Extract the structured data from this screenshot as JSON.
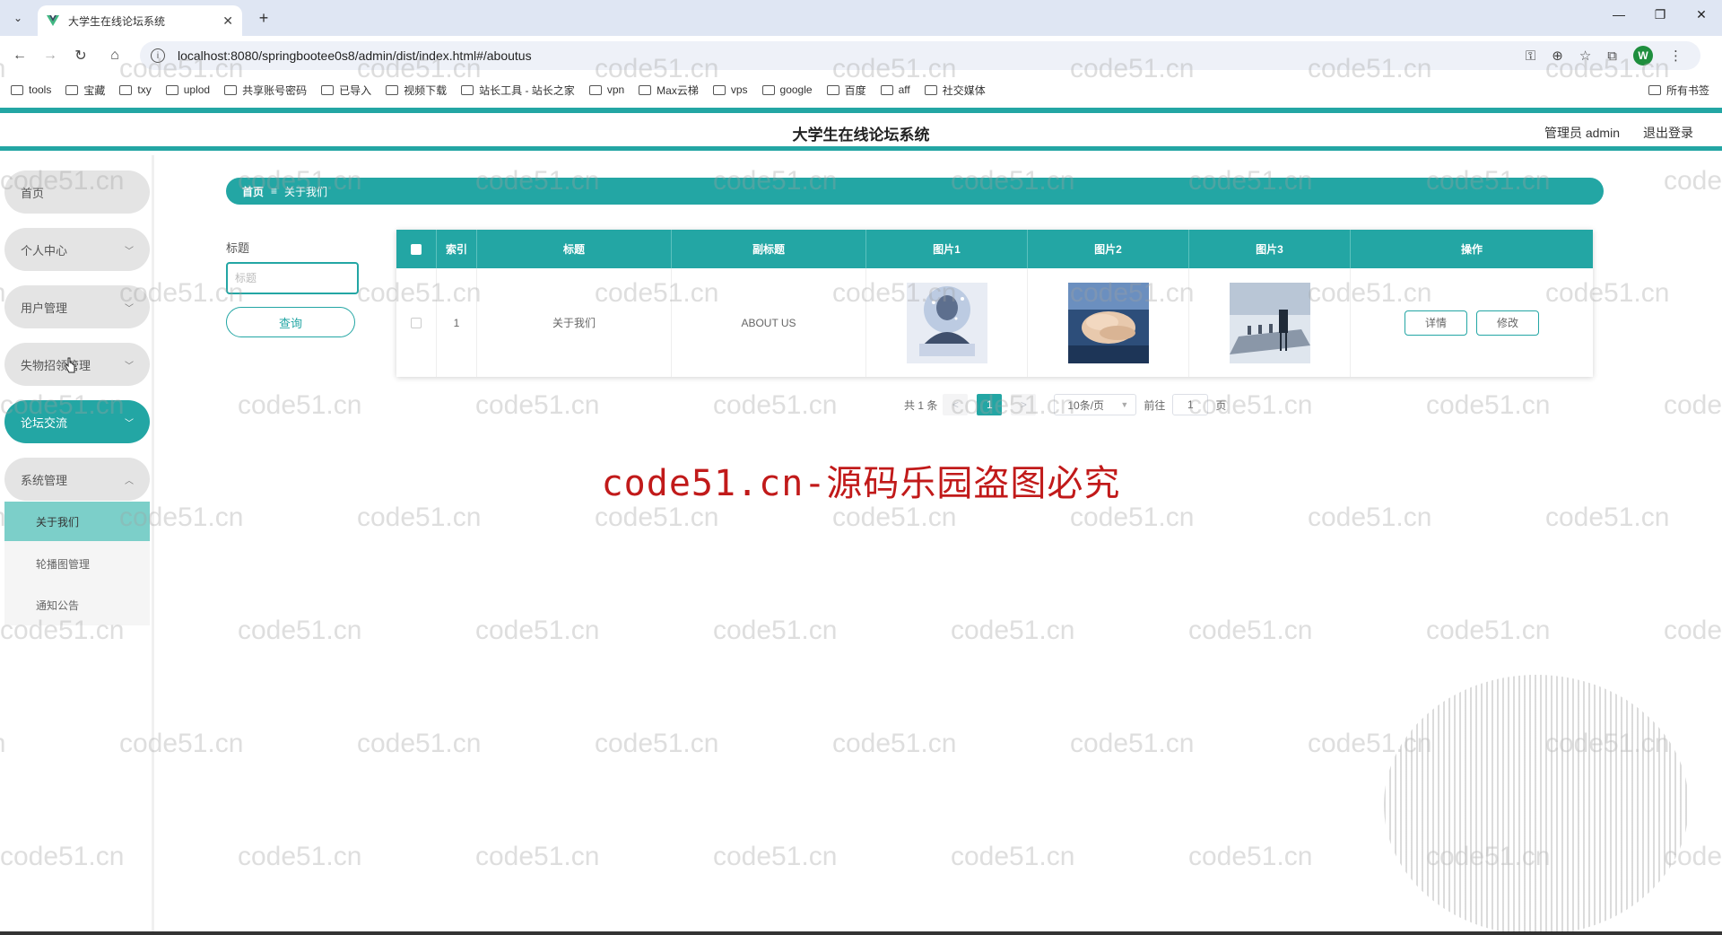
{
  "browser": {
    "tab_title": "大学生在线论坛系统",
    "url": "localhost:8080/springbootee0s8/admin/dist/index.html#/aboutus",
    "bookmarks": [
      "tools",
      "宝藏",
      "txy",
      "uplod",
      "共享账号密码",
      "已导入",
      "视频下载",
      "站长工具 - 站长之家",
      "vpn",
      "Max云梯",
      "vps",
      "google",
      "百度",
      "aff",
      "社交媒体"
    ],
    "all_bookmarks": "所有书签",
    "profile_initial": "W"
  },
  "header": {
    "title": "大学生在线论坛系统",
    "user": "管理员 admin",
    "logout": "退出登录"
  },
  "sidebar": {
    "items": [
      {
        "label": "首页"
      },
      {
        "label": "个人中心"
      },
      {
        "label": "用户管理"
      },
      {
        "label": "失物招领管理"
      },
      {
        "label": "论坛交流"
      },
      {
        "label": "系统管理"
      }
    ],
    "sub_items": [
      {
        "label": "关于我们"
      },
      {
        "label": "轮播图管理"
      },
      {
        "label": "通知公告"
      }
    ]
  },
  "breadcrumb": {
    "home": "首页",
    "separator": "≡",
    "current": "关于我们"
  },
  "search": {
    "label": "标题",
    "placeholder": "标题",
    "button": "查询"
  },
  "table": {
    "headers": [
      "索引",
      "标题",
      "副标题",
      "图片1",
      "图片2",
      "图片3",
      "操作"
    ],
    "rows": [
      {
        "index": "1",
        "title": "关于我们",
        "subtitle": "ABOUT US",
        "detail": "详情",
        "edit": "修改"
      }
    ]
  },
  "pagination": {
    "total": "共 1 条",
    "current_page": "1",
    "page_size": "10条/页",
    "goto_prefix": "前往",
    "goto_value": "1",
    "goto_suffix": "页"
  },
  "watermark": {
    "banner": "code51.cn-源码乐园盗图必究",
    "tile": "code51.cn"
  },
  "colors": {
    "accent": "#23a6a4",
    "banner": "#c11a1a"
  }
}
